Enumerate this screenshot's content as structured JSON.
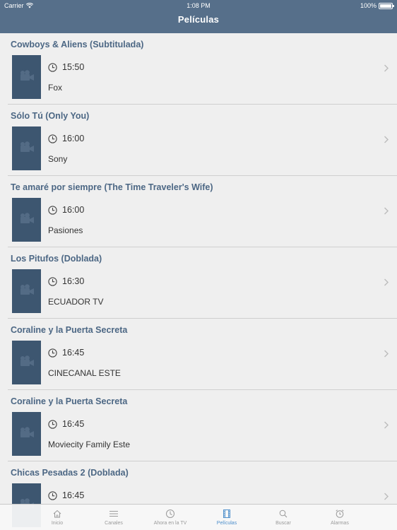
{
  "status_bar": {
    "carrier": "Carrier",
    "time": "1:08 PM",
    "battery": "100%"
  },
  "nav": {
    "title": "Películas"
  },
  "movies": [
    {
      "title": "Cowboys & Aliens (Subtitulada)",
      "time": "15:50",
      "channel": "Fox"
    },
    {
      "title": "Sólo Tú (Only You)",
      "time": "16:00",
      "channel": "Sony"
    },
    {
      "title": "Te amaré por siempre (The Time Traveler's Wife)",
      "time": "16:00",
      "channel": "Pasiones"
    },
    {
      "title": "Los Pitufos (Doblada)",
      "time": "16:30",
      "channel": "ECUADOR TV"
    },
    {
      "title": "Coraline y la Puerta Secreta",
      "time": "16:45",
      "channel": "CINECANAL ESTE"
    },
    {
      "title": "Coraline y la Puerta Secreta",
      "time": "16:45",
      "channel": "Moviecity Family Este"
    },
    {
      "title": "Chicas Pesadas 2 (Doblada)",
      "time": "16:45",
      "channel": ""
    }
  ],
  "tabs": [
    {
      "label": "Inicio",
      "icon": "home-icon"
    },
    {
      "label": "Canales",
      "icon": "list-icon"
    },
    {
      "label": "Ahora en la TV",
      "icon": "clock-icon"
    },
    {
      "label": "Películas",
      "icon": "film-icon",
      "active": true
    },
    {
      "label": "Buscar",
      "icon": "search-icon"
    },
    {
      "label": "Alarmas",
      "icon": "alarm-icon"
    }
  ],
  "colors": {
    "nav_bar": "#566f8a",
    "title_text": "#4c6784",
    "thumb": "#3d5670",
    "active_tab": "#4e8fcb"
  }
}
